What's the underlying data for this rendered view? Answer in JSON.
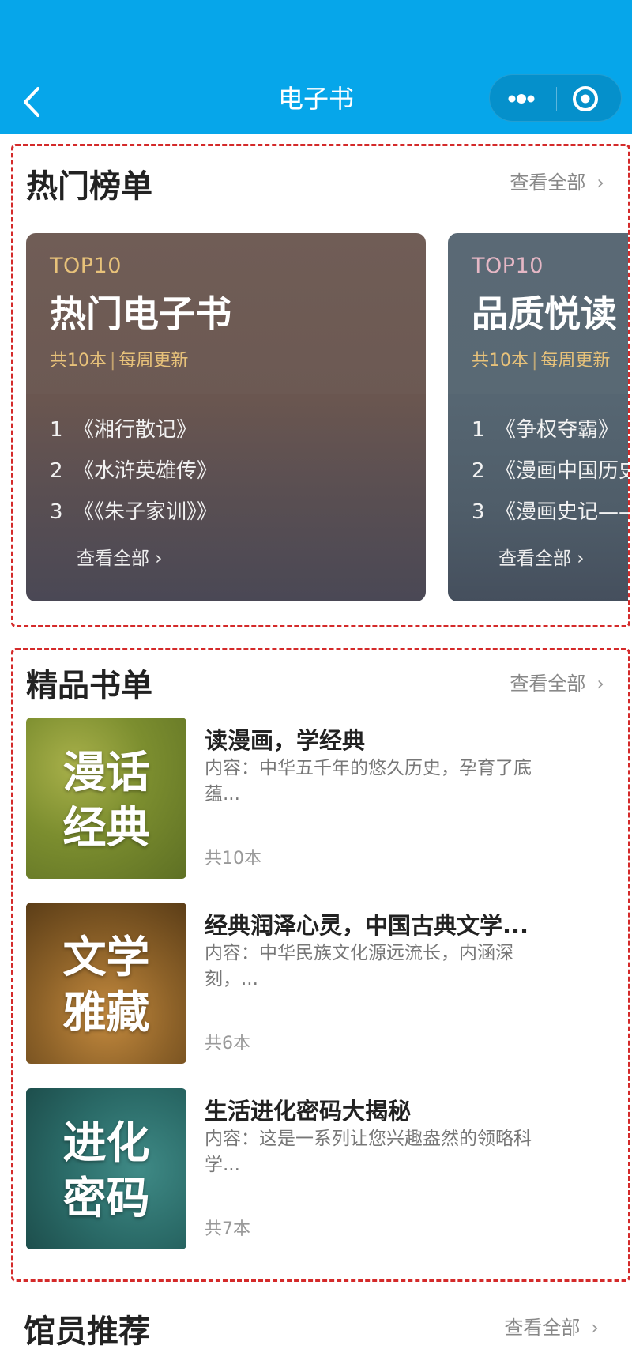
{
  "nav": {
    "title": "电子书",
    "back_icon": "chevron-left-icon",
    "more_icon": "more-dots-icon",
    "close_icon": "target-circle-icon",
    "bar_color": "#06a6ea"
  },
  "hot": {
    "title": "热门榜单",
    "more_label": "查看全部",
    "cards": [
      {
        "tag": "TOP10",
        "name": "热门电子书",
        "count": "共10本",
        "update": "每周更新",
        "items": [
          {
            "num": "1",
            "title": "《湘行散记》"
          },
          {
            "num": "2",
            "title": "《水浒英雄传》"
          },
          {
            "num": "3",
            "title": "《《朱子家训》》"
          }
        ],
        "more_label": "查看全部 ›"
      },
      {
        "tag": "TOP10",
        "name": "品质悦读",
        "count": "共10本",
        "update": "每周更新",
        "items": [
          {
            "num": "1",
            "title": "《争权夺霸》"
          },
          {
            "num": "2",
            "title": "《漫画中国历史"
          },
          {
            "num": "3",
            "title": "《漫画史记——"
          }
        ],
        "more_label": "查看全部 ›"
      }
    ]
  },
  "booklists": {
    "title": "精品书单",
    "more_label": "查看全部",
    "items": [
      {
        "cover_line1": "漫话",
        "cover_line2": "经典",
        "title": "读漫画，学经典",
        "desc": "内容：中华五千年的悠久历史，孕育了底蕴...",
        "count": "共10本"
      },
      {
        "cover_line1": "文学",
        "cover_line2": "雅藏",
        "title": "经典润泽心灵，中国古典文学...",
        "desc": "内容：中华民族文化源远流长，内涵深刻，...",
        "count": "共6本"
      },
      {
        "cover_line1": "进化",
        "cover_line2": "密码",
        "title": "生活进化密码大揭秘",
        "desc": "内容：这是一系列让您兴趣盎然的领略科学...",
        "count": "共7本"
      }
    ]
  },
  "staff": {
    "title": "馆员推荐",
    "more_label": "查看全部"
  }
}
